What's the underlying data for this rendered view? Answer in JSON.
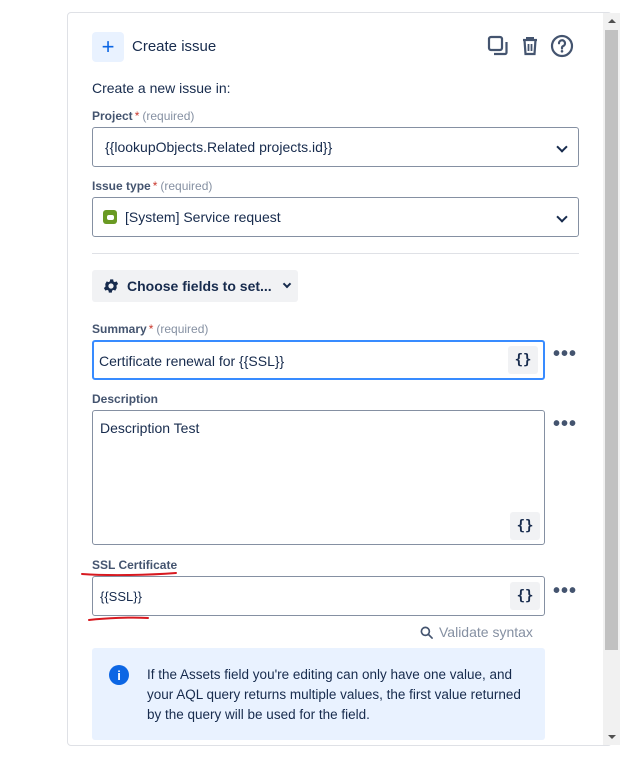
{
  "header": {
    "title": "Create issue",
    "plus_glyph": "+",
    "icons": [
      "duplicate-icon",
      "trash-icon",
      "help-icon"
    ]
  },
  "subtitle": "Create a new issue in:",
  "project": {
    "label": "Project",
    "required_mark": "*",
    "required_text": "(required)",
    "value": "{{lookupObjects.Related projects.id}}"
  },
  "issue_type": {
    "label": "Issue type",
    "required_mark": "*",
    "required_text": "(required)",
    "value": "[System] Service request",
    "icon_color": "#6a9a23"
  },
  "choose_fields": {
    "label": "Choose fields to set..."
  },
  "summary": {
    "label": "Summary",
    "required_mark": "*",
    "required_text": "(required)",
    "value": "Certificate renewal for {{SSL}}"
  },
  "description": {
    "label": "Description",
    "value": "Description Test"
  },
  "ssl": {
    "label": "SSL Certificate",
    "value": "{{SSL}}"
  },
  "smart_value_button": "{}",
  "more_glyph": "•••",
  "validate_label": "Validate syntax",
  "info": {
    "icon_glyph": "i",
    "text": "If the Assets field you're editing can only have one value, and your AQL query returns multiple values, the first value returned by the query will be used for the field."
  },
  "colors": {
    "accent": "#0c66e4",
    "focus_border": "#388bff",
    "annotation": "#d71920",
    "info_bg": "#e9f2ff"
  }
}
